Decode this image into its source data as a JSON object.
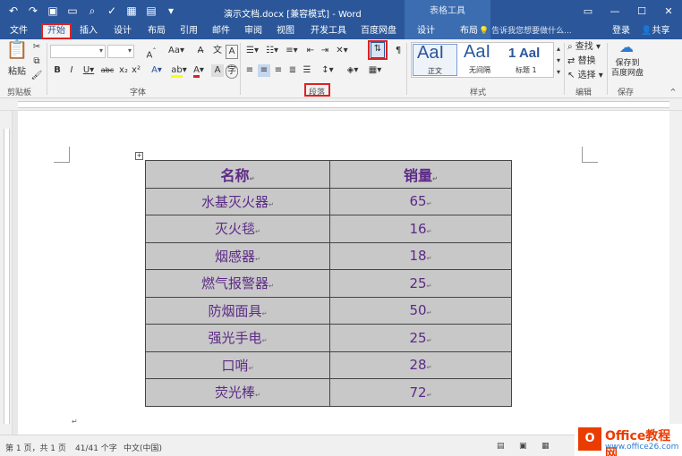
{
  "titlebar": {
    "title": "演示文档.docx [兼容模式] - Word",
    "context_title": "表格工具",
    "qat_icons": [
      "undo-icon",
      "redo-icon",
      "save-icon",
      "new-icon",
      "print-preview-icon",
      "spell-icon",
      "table-icon",
      "open-icon",
      "more-icon"
    ],
    "window_buttons": [
      "ribbon-display-icon",
      "minimize-icon",
      "maximize-icon",
      "close-icon"
    ]
  },
  "tabs": [
    "文件",
    "开始",
    "插入",
    "设计",
    "布局",
    "引用",
    "邮件",
    "审阅",
    "视图",
    "开发工具",
    "百度网盘",
    "设计",
    "布局"
  ],
  "active_tab": "开始",
  "tell_me": "告诉我您想要做什么...",
  "login": "登录",
  "share": "共享",
  "ribbon": {
    "paste_label": "粘贴",
    "groups": {
      "clipboard": "剪贴板",
      "font": "字体",
      "paragraph": "段落",
      "styles": "样式",
      "editing": "编辑",
      "save": "保存"
    },
    "styles_list": [
      {
        "sample": "AaI",
        "name": "正文"
      },
      {
        "sample": "AaI",
        "name": "无间隔"
      },
      {
        "sample": "1 Aal",
        "name": "标题 1"
      }
    ],
    "editing": {
      "find": "查找",
      "replace": "替换",
      "select": "选择"
    },
    "save_btn": "保存到\n百度网盘"
  },
  "table": {
    "headers": [
      "名称",
      "销量"
    ],
    "rows": [
      [
        "水基灭火器",
        "65"
      ],
      [
        "灭火毯",
        "16"
      ],
      [
        "烟感器",
        "18"
      ],
      [
        "燃气报警器",
        "25"
      ],
      [
        "防烟面具",
        "50"
      ],
      [
        "强光手电",
        "25"
      ],
      [
        "口哨",
        "28"
      ],
      [
        "荧光棒",
        "72"
      ]
    ]
  },
  "status": {
    "page": "第 1 页，共 1 页",
    "words": "41/41 个字",
    "language": "中文(中国)"
  },
  "watermark": {
    "line1": "Office教程网",
    "line2": "www.office26.com"
  },
  "colors": {
    "ribbon_blue": "#2b579a",
    "highlight_red": "#e02020",
    "table_text": "#5c2a86",
    "table_fill": "#c8c8c8"
  }
}
